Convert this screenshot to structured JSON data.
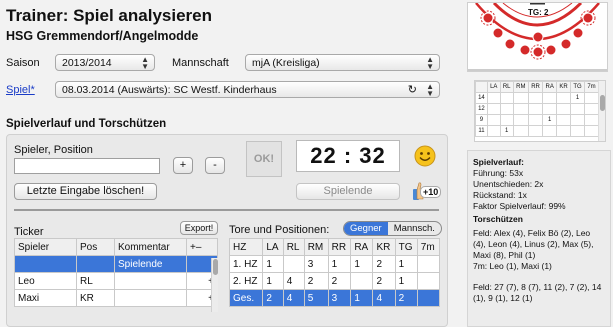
{
  "header": {
    "title": "Trainer: Spiel analysieren",
    "team": "HSG Gremmendorf/Angelmodde"
  },
  "filters": {
    "season_label": "Saison",
    "season_value": "2013/2014",
    "team_label": "Mannschaft",
    "team_value": "mjA (Kreisliga)",
    "game_link": "Spiel*",
    "game_value": "08.03.2014 (Auswärts): SC Westf. Kinderhaus"
  },
  "game_section": {
    "title": "Spielverlauf und Torschützen",
    "player_label": "Spieler, Position",
    "player_value": "",
    "plus": "+",
    "minus": "-",
    "ok": "OK!",
    "clock": "22 : 32",
    "clear_last": "Letzte Eingabe löschen!",
    "end_game": "Spielende",
    "thumb_badge": "+10"
  },
  "ticker": {
    "title": "Ticker",
    "export": "Export!",
    "columns": [
      "Spieler",
      "Pos",
      "Kommentar",
      "+–"
    ],
    "rows": [
      {
        "player": "",
        "pos": "",
        "comment": "Spielende",
        "pm": ""
      },
      {
        "player": "Leo",
        "pos": "RL",
        "comment": "",
        "pm": "+"
      },
      {
        "player": "Maxi",
        "pos": "KR",
        "comment": "",
        "pm": "+"
      }
    ]
  },
  "goals": {
    "title": "Tore und Positionen:",
    "toggle": [
      "Gegner",
      "Mannsch."
    ],
    "columns": [
      "HZ",
      "LA",
      "RL",
      "RM",
      "RR",
      "RA",
      "KR",
      "TG",
      "7m"
    ],
    "rows": [
      [
        "1. HZ",
        "1",
        "",
        "3",
        "1",
        "1",
        "2",
        "1",
        ""
      ],
      [
        "2. HZ",
        "1",
        "4",
        "2",
        "2",
        "",
        "2",
        "1",
        ""
      ],
      [
        "Ges.",
        "2",
        "4",
        "5",
        "3",
        "1",
        "4",
        "2",
        ""
      ]
    ]
  },
  "field": {
    "tg_label": "TG: 2"
  },
  "mini_table": {
    "columns": [
      "",
      "LA",
      "RL",
      "RM",
      "RR",
      "RA",
      "KR",
      "TG",
      "7m"
    ],
    "rows": [
      [
        "14",
        "",
        "",
        "",
        "",
        "",
        "",
        "1",
        ""
      ],
      [
        "12",
        "",
        "",
        "",
        "",
        "",
        "",
        "",
        ""
      ],
      [
        "9",
        "",
        "",
        "",
        "",
        "1",
        "",
        "",
        ""
      ],
      [
        "11",
        "",
        "1",
        "",
        "",
        "",
        "",
        "",
        ""
      ]
    ]
  },
  "summary": {
    "heading": "Spielverlauf:",
    "lines": [
      "Führung: 53x",
      "Unentschieden: 2x",
      "Rückstand: 1x",
      "Faktor Spielverlauf: 99%"
    ],
    "scorers_heading": "Torschützen",
    "scorers_field": "Feld: Alex (4), Felix Bö (2), Leo (4), Leon (4), Linus (2), Max (5), Maxi (8), Phil (1)",
    "scorers_7m": "7m: Leo (1), Maxi (1)",
    "opponent_field": "Feld: 27 (7), 8 (7), 11 (2), 7 (2), 14 (1), 9 (1), 12 (1)"
  },
  "colors": {
    "accent": "#3b76d8",
    "field_red": "#d42a2a",
    "link": "#1a3cc7"
  }
}
